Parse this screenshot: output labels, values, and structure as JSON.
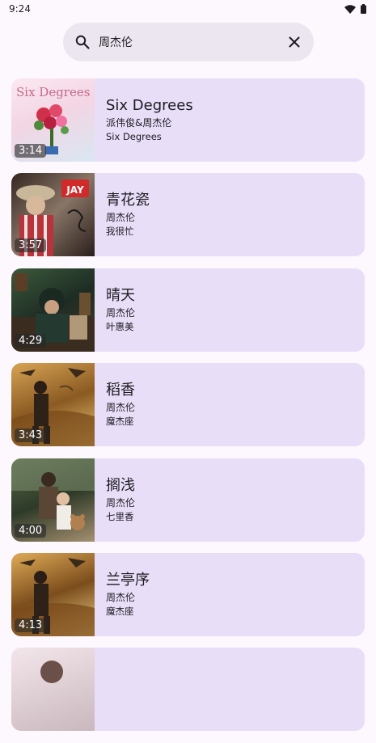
{
  "status": {
    "time": "9:24"
  },
  "search": {
    "query": "周杰伦"
  },
  "songs": [
    {
      "title": "Six Degrees",
      "artist": "派伟俊&周杰伦",
      "album": "Six Degrees",
      "duration": "3:14"
    },
    {
      "title": "青花瓷",
      "artist": "周杰伦",
      "album": "我很忙",
      "duration": "3:57"
    },
    {
      "title": "晴天",
      "artist": "周杰伦",
      "album": "叶惠美",
      "duration": "4:29"
    },
    {
      "title": "稻香",
      "artist": "周杰伦",
      "album": "魔杰座",
      "duration": "3:43"
    },
    {
      "title": "搁浅",
      "artist": "周杰伦",
      "album": "七里香",
      "duration": "4:00"
    },
    {
      "title": "兰亭序",
      "artist": "周杰伦",
      "album": "魔杰座",
      "duration": "4:13"
    }
  ],
  "cover_text": {
    "six_degrees": "Six Degrees",
    "jay": "JAY"
  },
  "colors": {
    "background": "#fdf7fe",
    "card": "#e8def8",
    "search_bar": "#ece6f0"
  }
}
